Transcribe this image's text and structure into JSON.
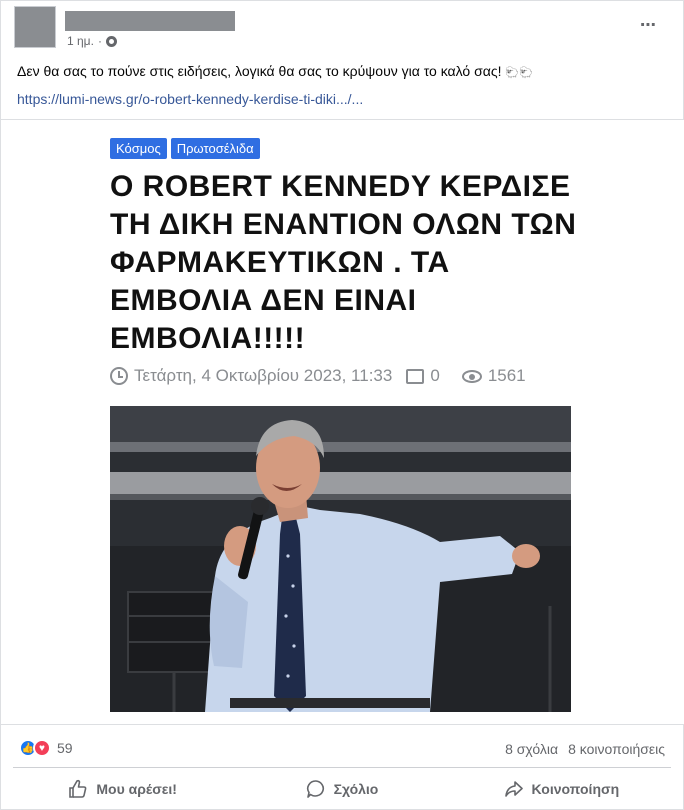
{
  "post": {
    "time": "1 ημ.",
    "separator": "·",
    "more_icon": "⋯",
    "text": "Δεν θα σας το πούνε στις ειδήσεις, λογικά  θα σας το κρύψουν για το καλό σας!",
    "emoji": "🐑🐑",
    "link": "https://lumi-news.gr/o-robert-kennedy-kerdise-ti-diki.../..."
  },
  "article": {
    "tags": [
      "Κόσμος",
      "Πρωτοσέλιδα"
    ],
    "headline": "Ο ROBERT KENNEDY ΚΕΡΔΙΣΕ ΤΗ ΔΙΚΗ ΕΝΑΝΤΙΟΝ ΟΛΩΝ ΤΩΝ ΦΑΡΜΑΚΕΥΤΙΚΩΝ . ΤΑ ΕΜΒΟΛΙΑ ΔΕΝ ΕΙΝΑΙ ΕΜΒΟΛΙΑ!!!!!",
    "date": "Τετάρτη, 4 Οκτωβρίου 2023, 11:33",
    "comments": "0",
    "views": "1561"
  },
  "engagement": {
    "reaction_count": "59",
    "comments": "8 σχόλια",
    "shares": "8 κοινοποιήσεις"
  },
  "actions": {
    "like": "Μου αρέσει!",
    "comment": "Σχόλιο",
    "share": "Κοινοποίηση"
  },
  "colors": {
    "tag_bg": "#2f6ee2",
    "link": "#385898",
    "like_blue": "#1877f2",
    "heart_red": "#f33e58"
  }
}
